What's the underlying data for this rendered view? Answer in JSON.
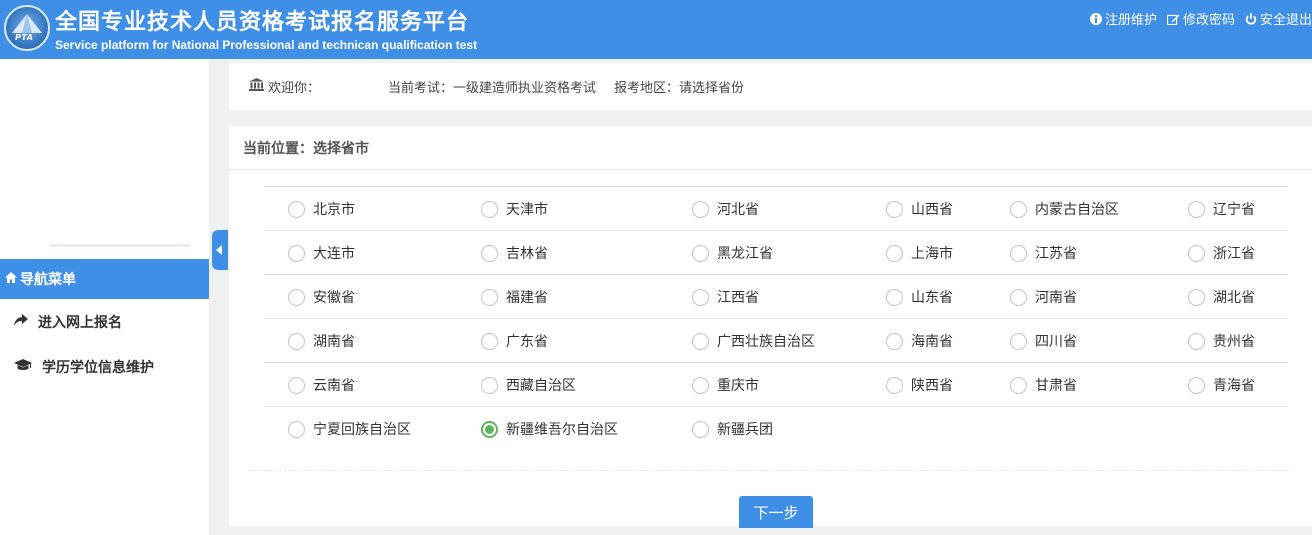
{
  "header": {
    "logo_text": "PTA",
    "title": "全国专业技术人员资格考试报名服务平台",
    "subtitle": "Service platform for National Professional and technican qualification test",
    "links": [
      {
        "label": "注册维护",
        "icon": "info-circle-icon"
      },
      {
        "label": "修改密码",
        "icon": "edit-icon"
      },
      {
        "label": "安全退出",
        "icon": "power-icon"
      }
    ]
  },
  "sidebar": {
    "nav_header": "导航菜单",
    "items": [
      {
        "label": "进入网上报名",
        "icon": "share-arrow-icon"
      },
      {
        "label": "学历学位信息维护",
        "icon": "graduation-cap-icon"
      }
    ]
  },
  "infobar": {
    "welcome": "欢迎你：",
    "current_exam": "当前考试：一级建造师执业资格考试",
    "region": "报考地区：请选择省份"
  },
  "panel": {
    "title": "当前位置：选择省市",
    "selected": "新疆维吾尔自治区",
    "provinces": [
      [
        "北京市",
        "天津市",
        "河北省",
        "山西省",
        "内蒙古自治区",
        "辽宁省"
      ],
      [
        "大连市",
        "吉林省",
        "黑龙江省",
        "上海市",
        "江苏省",
        "浙江省"
      ],
      [
        "安徽省",
        "福建省",
        "江西省",
        "山东省",
        "河南省",
        "湖北省"
      ],
      [
        "湖南省",
        "广东省",
        "广西壮族自治区",
        "海南省",
        "四川省",
        "贵州省"
      ],
      [
        "云南省",
        "西藏自治区",
        "重庆市",
        "陕西省",
        "甘肃省",
        "青海省"
      ],
      [
        "宁夏回族自治区",
        "新疆维吾尔自治区",
        "新疆兵团"
      ]
    ],
    "next_button": "下一步"
  },
  "colors": {
    "accent": "#3f8fe6",
    "checked": "#5ab55a"
  }
}
